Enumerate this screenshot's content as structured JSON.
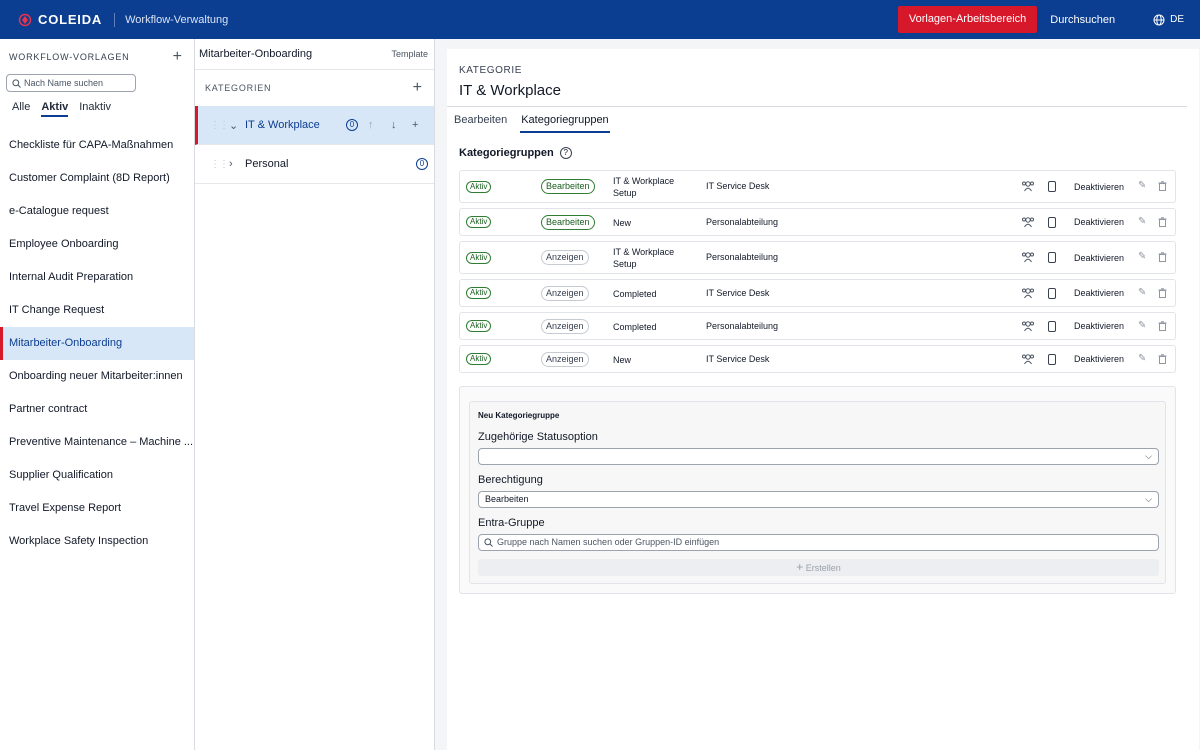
{
  "header": {
    "brand": "COLEIDA",
    "app_title": "Workflow-Verwaltung",
    "workspace_button": "Vorlagen-Arbeitsbereich",
    "search_link": "Durchsuchen",
    "language": "DE",
    "brand_color": "#0b3d91",
    "accent_color": "#d7182a"
  },
  "templates": {
    "title": "WORKFLOW-VORLAGEN",
    "search_placeholder": "Nach Name suchen",
    "filters": [
      "Alle",
      "Aktiv",
      "Inaktiv"
    ],
    "active_filter": "Aktiv",
    "items": [
      "Checkliste für CAPA-Maßnahmen",
      "Customer Complaint (8D Report)",
      "e-Catalogue request",
      "Employee Onboarding",
      "Internal Audit Preparation",
      "IT Change Request",
      "Mitarbeiter-Onboarding",
      "Onboarding neuer Mitarbeiter:innen",
      "Partner contract",
      "Preventive Maintenance – Machine ...",
      "Supplier Qualification",
      "Travel Expense Report",
      "Workplace Safety Inspection"
    ],
    "selected": "Mitarbeiter-Onboarding"
  },
  "template_panel": {
    "title": "Mitarbeiter-Onboarding",
    "badge": "Template",
    "categories_label": "KATEGORIEN",
    "categories": [
      {
        "label": "IT & Workplace",
        "count": "0",
        "expanded": true,
        "selected": true
      },
      {
        "label": "Personal",
        "count": "0",
        "expanded": false,
        "selected": false
      }
    ]
  },
  "category": {
    "kicker": "KATEGORIE",
    "title": "IT & Workplace",
    "tabs": [
      "Bearbeiten",
      "Kategoriegruppen"
    ],
    "active_tab": "Kategoriegruppen",
    "section_title": "Kategoriegruppen",
    "help_icon": "?",
    "rows": [
      {
        "state": "Aktiv",
        "permission": "Bearbeiten",
        "status": "IT & Workplace Setup",
        "group": "IT Service Desk",
        "action": "Deaktivieren"
      },
      {
        "state": "Aktiv",
        "permission": "Bearbeiten",
        "status": "New",
        "group": "Personalabteilung",
        "action": "Deaktivieren"
      },
      {
        "state": "Aktiv",
        "permission": "Anzeigen",
        "status": "IT & Workplace Setup",
        "group": "Personalabteilung",
        "action": "Deaktivieren"
      },
      {
        "state": "Aktiv",
        "permission": "Anzeigen",
        "status": "Completed",
        "group": "IT Service Desk",
        "action": "Deaktivieren"
      },
      {
        "state": "Aktiv",
        "permission": "Anzeigen",
        "status": "Completed",
        "group": "Personalabteilung",
        "action": "Deaktivieren"
      },
      {
        "state": "Aktiv",
        "permission": "Anzeigen",
        "status": "New",
        "group": "IT Service Desk",
        "action": "Deaktivieren"
      }
    ]
  },
  "new_group": {
    "title": "Neu Kategoriegruppe",
    "status_label": "Zugehörige Statusoption",
    "status_value": "",
    "permission_label": "Berechtigung",
    "permission_value": "Bearbeiten",
    "entra_label": "Entra-Gruppe",
    "entra_placeholder": "Gruppe nach Namen suchen oder Gruppen-ID einfügen",
    "create_label": "Erstellen"
  }
}
